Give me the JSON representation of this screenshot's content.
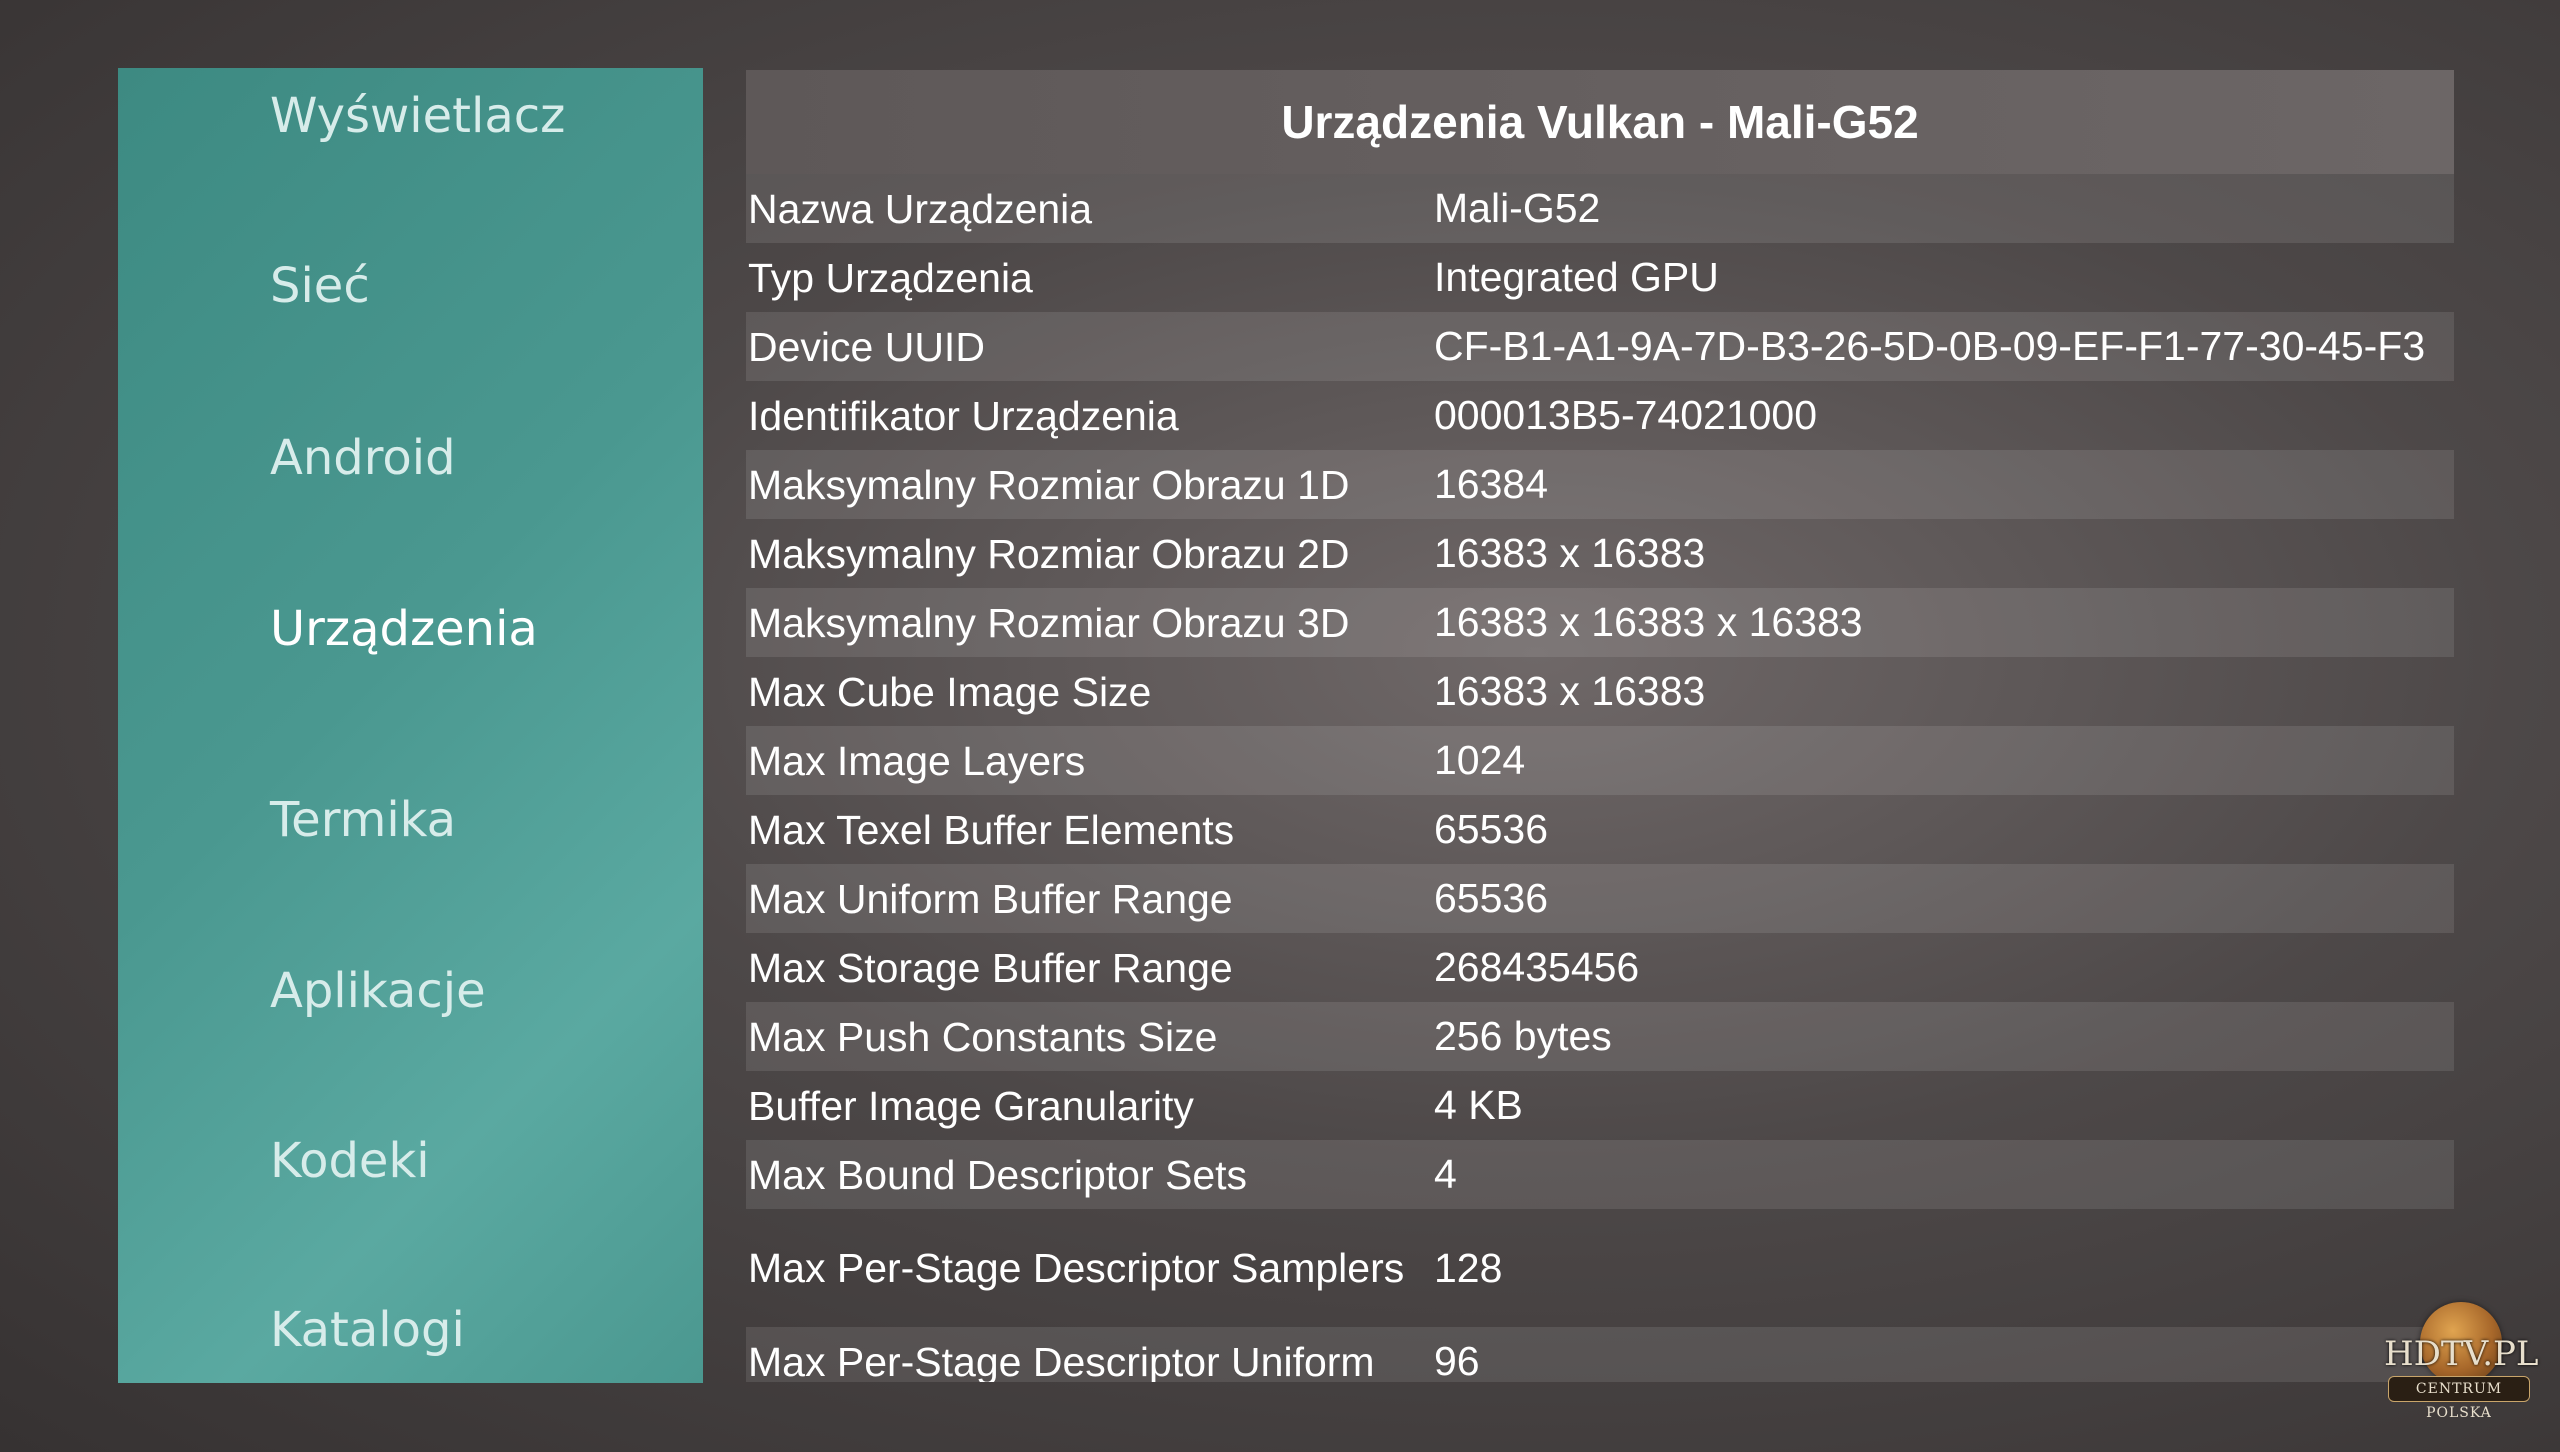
{
  "sidebar": {
    "items": [
      {
        "label": "Wyświetlacz"
      },
      {
        "label": "Sieć"
      },
      {
        "label": "Android"
      },
      {
        "label": "Urządzenia"
      },
      {
        "label": "Termika"
      },
      {
        "label": "Aplikacje"
      },
      {
        "label": "Kodeki"
      },
      {
        "label": "Katalogi"
      }
    ],
    "active": "Urządzenia"
  },
  "panel": {
    "title": "Urządzenia Vulkan - Mali-G52",
    "rows": [
      {
        "key": "Nazwa Urządzenia",
        "value": "Mali-G52"
      },
      {
        "key": "Typ Urządzenia",
        "value": "Integrated GPU"
      },
      {
        "key": "Device UUID",
        "value": "CF-B1-A1-9A-7D-B3-26-5D-0B-09-EF-F1-77-30-45-F3"
      },
      {
        "key": "Identifikator Urządzenia",
        "value": "000013B5-74021000"
      },
      {
        "key": "Maksymalny Rozmiar Obrazu 1D",
        "value": "16384"
      },
      {
        "key": "Maksymalny Rozmiar Obrazu 2D",
        "value": "16383 x 16383"
      },
      {
        "key": "Maksymalny Rozmiar Obrazu 3D",
        "value": "16383 x 16383 x 16383"
      },
      {
        "key": "Max Cube Image Size",
        "value": "16383 x 16383"
      },
      {
        "key": "Max Image Layers",
        "value": "1024"
      },
      {
        "key": "Max Texel Buffer Elements",
        "value": "65536"
      },
      {
        "key": "Max Uniform Buffer Range",
        "value": "65536"
      },
      {
        "key": "Max Storage Buffer Range",
        "value": "268435456"
      },
      {
        "key": "Max Push Constants Size",
        "value": "256 bytes"
      },
      {
        "key": "Buffer Image Granularity",
        "value": "4 KB"
      },
      {
        "key": "Max Bound Descriptor Sets",
        "value": "4"
      },
      {
        "key": "Max Per-Stage Descriptor Samplers",
        "value": "128"
      },
      {
        "key": "Max Per-Stage Descriptor Uniform",
        "value": "96"
      }
    ]
  },
  "watermark": {
    "title": "HDTV.PL",
    "subtitle": "CENTRUM POLSKA"
  }
}
